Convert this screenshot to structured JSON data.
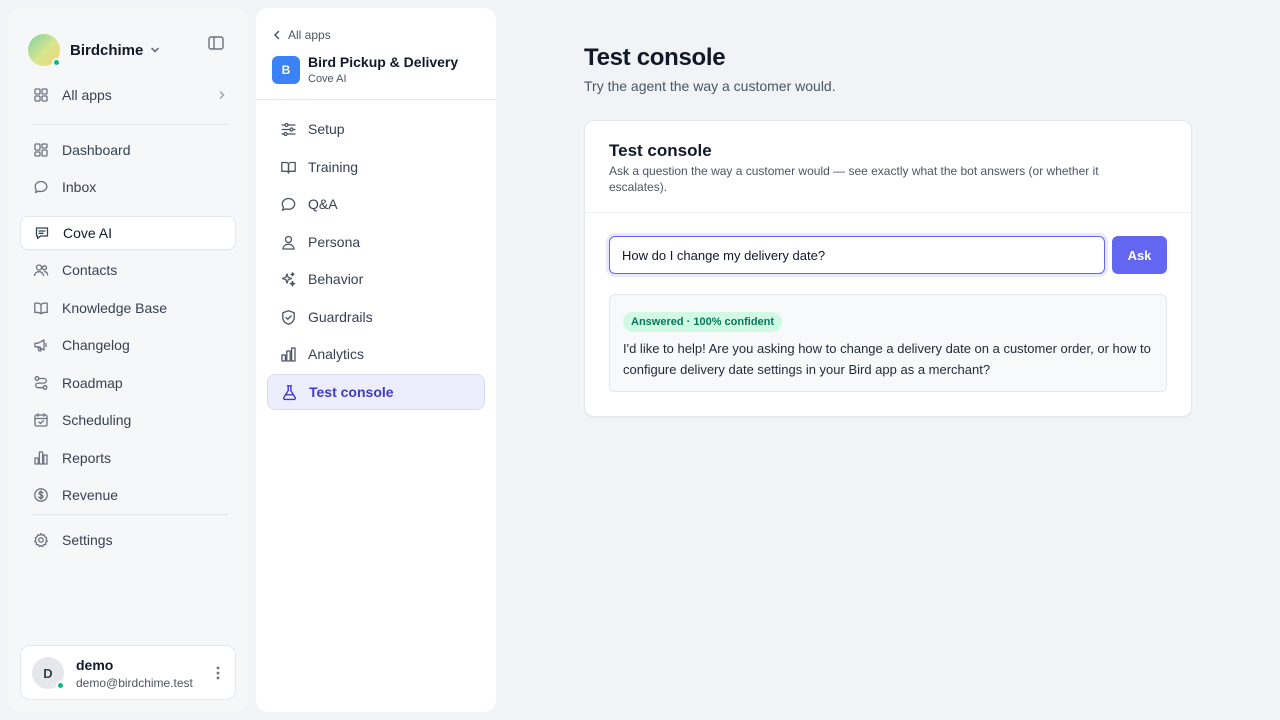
{
  "colors": {
    "accent": "#6366f1",
    "active_nav_text": "#4338ca",
    "online": "#10b981",
    "app_badge": "#3b82f6",
    "success_badge_bg": "#d1fae5",
    "success_badge_text": "#047857"
  },
  "workspace": {
    "name": "Birdchime",
    "icon": "gradient-avatar"
  },
  "sidebar": {
    "all_apps": {
      "label": "All apps",
      "icon": "grid-icon"
    },
    "items": [
      {
        "label": "Dashboard",
        "icon": "dashboard-icon"
      },
      {
        "label": "Inbox",
        "icon": "chat-bubble-icon"
      },
      {
        "label": "Cove AI",
        "icon": "chat-square-icon",
        "active": true
      },
      {
        "label": "Contacts",
        "icon": "users-icon"
      },
      {
        "label": "Knowledge Base",
        "icon": "book-icon"
      },
      {
        "label": "Changelog",
        "icon": "megaphone-icon"
      },
      {
        "label": "Roadmap",
        "icon": "route-icon"
      },
      {
        "label": "Scheduling",
        "icon": "calendar-icon"
      },
      {
        "label": "Reports",
        "icon": "bar-chart-icon"
      },
      {
        "label": "Revenue",
        "icon": "dollar-icon"
      }
    ],
    "settings": {
      "label": "Settings",
      "icon": "gear-icon"
    }
  },
  "user": {
    "initial": "D",
    "name": "demo",
    "email": "demo@birdchime.test"
  },
  "app_nav": {
    "back_label": "All apps",
    "badge_letter": "B",
    "app_name": "Bird Pickup & Delivery",
    "app_subtitle": "Cove AI",
    "items": [
      {
        "label": "Setup",
        "icon": "sliders-icon"
      },
      {
        "label": "Training",
        "icon": "open-book-icon"
      },
      {
        "label": "Q&A",
        "icon": "chat-bubble-icon"
      },
      {
        "label": "Persona",
        "icon": "person-icon"
      },
      {
        "label": "Behavior",
        "icon": "sparkles-icon"
      },
      {
        "label": "Guardrails",
        "icon": "shield-check-icon"
      },
      {
        "label": "Analytics",
        "icon": "bar-chart-icon"
      },
      {
        "label": "Test console",
        "icon": "flask-icon",
        "active": true
      }
    ]
  },
  "page": {
    "title": "Test console",
    "subtitle": "Try the agent the way a customer would."
  },
  "console": {
    "title": "Test console",
    "description": "Ask a question the way a customer would — see exactly what the bot answers (or whether it escalates).",
    "question_value": "How do I change my delivery date?",
    "ask_label": "Ask",
    "answer_badge": "Answered · 100% confident",
    "answer_text": "I'd like to help! Are you asking how to change a delivery date on a customer order, or how to configure delivery date settings in your Bird app as a merchant?"
  }
}
